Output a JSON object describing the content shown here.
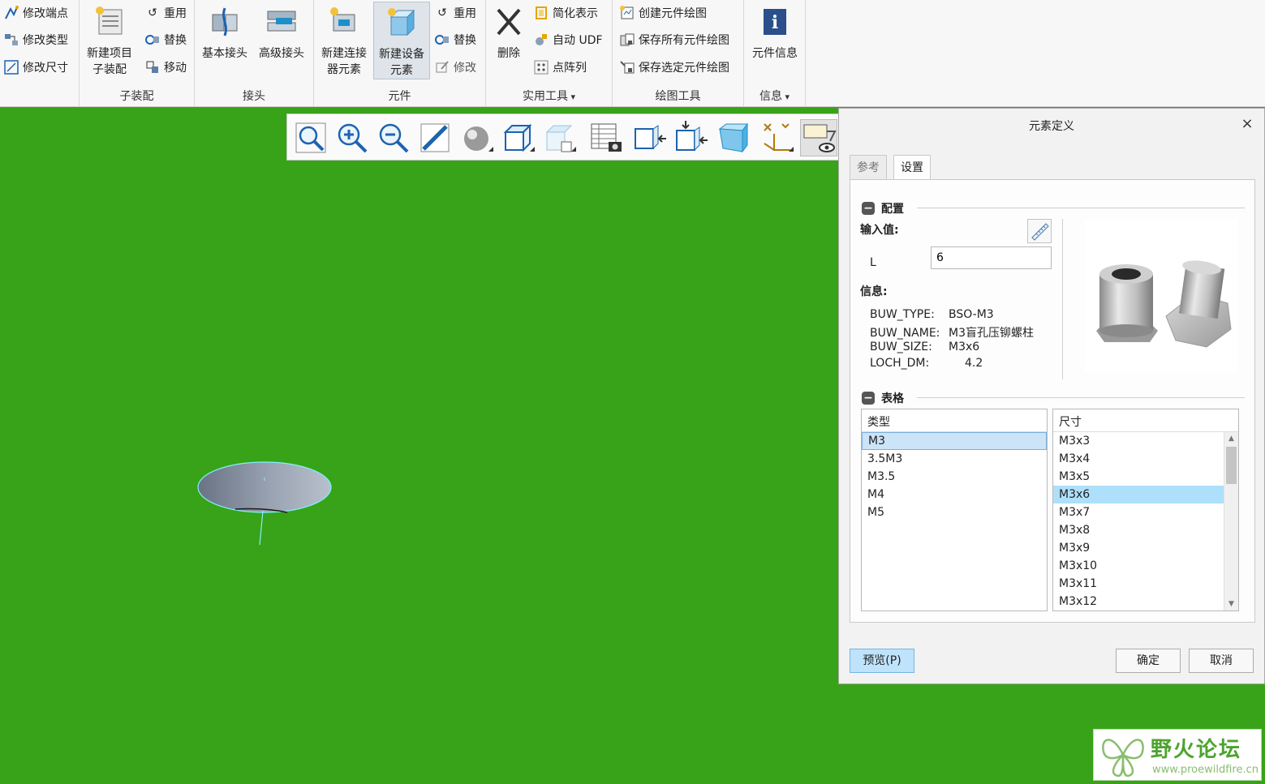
{
  "ribbon": {
    "group1": {
      "items": [
        "修改端点",
        "修改类型",
        "修改尺寸"
      ]
    },
    "subassembly": {
      "label": "子装配",
      "new_item": "新建项目\n子装配",
      "reuse": "重用",
      "replace": "替换",
      "move": "移动"
    },
    "connector": {
      "label": "接头",
      "basic": "基本接头",
      "advanced": "高级接头"
    },
    "component": {
      "label": "元件",
      "new_connector": "新建连接\n器元素",
      "new_device": "新建设备\n元素",
      "reuse": "重用",
      "replace": "替换",
      "modify": "修改"
    },
    "utility": {
      "label": "实用工具",
      "delete": "删除",
      "simplify": "简化表示",
      "auto_udf": "自动 UDF",
      "point_array": "点阵列"
    },
    "drawing": {
      "label": "绘图工具",
      "create": "创建元件绘图",
      "save_all": "保存所有元件绘图",
      "save_selected": "保存选定元件绘图"
    },
    "info": {
      "label": "信息",
      "component_info": "元件信息"
    }
  },
  "dialog": {
    "title": "元素定义",
    "close": "×",
    "tabs": [
      "参考",
      "设置"
    ],
    "config_section": "配置",
    "input_values_label": "输入值:",
    "param_name": "L",
    "param_value": "6",
    "info_label": "信息:",
    "info_rows": [
      {
        "key": "BUW_TYPE:",
        "value": "BSO-M3"
      },
      {
        "key": "BUW_NAME:",
        "value": "M3盲孔压铆螺柱"
      },
      {
        "key": "BUW_SIZE:",
        "value": "M3x6"
      },
      {
        "key": "LOCH_DM:",
        "value": "4.2"
      }
    ],
    "table_section": "表格",
    "type_list": {
      "header": "类型",
      "items": [
        "M3",
        "3.5M3",
        "M3.5",
        "M4",
        "M5"
      ],
      "selected": "M3"
    },
    "size_list": {
      "header": "尺寸",
      "items": [
        "M3x3",
        "M3x4",
        "M3x5",
        "M3x6",
        "M3x7",
        "M3x8",
        "M3x9",
        "M3x10",
        "M3x11",
        "M3x12"
      ],
      "selected": "M3x6"
    },
    "buttons": {
      "preview": "预览(P)",
      "ok": "确定",
      "cancel": "取消"
    }
  },
  "watermark": {
    "title": "野火论坛",
    "url": "www.proewildfire.cn"
  },
  "colors": {
    "viewport_bg": "#38a318",
    "selection": "#aee0fb",
    "accent": "#1d63b0"
  }
}
